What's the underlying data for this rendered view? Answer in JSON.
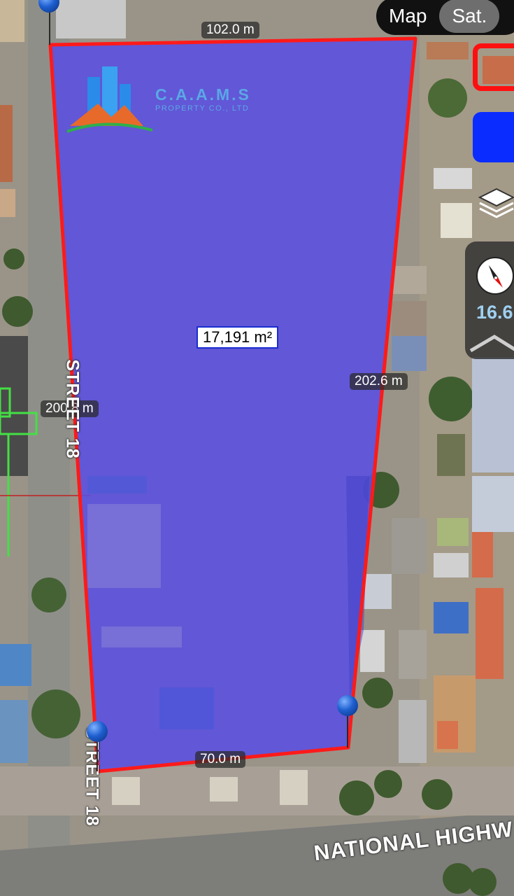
{
  "map": {
    "mode_toggle": {
      "options": [
        "Map",
        "Sat."
      ],
      "selected": "Sat."
    },
    "zoom_level": "16.6",
    "area_label": "17,191 m²",
    "edge_labels": {
      "top": "102.0 m",
      "right": "202.6 m",
      "left": "200.8 m",
      "bottom": "70.0 m"
    },
    "street_labels": {
      "left_upper": "STREET 18",
      "left_lower": "STREET 18",
      "highway": "NATIONAL HIGHW"
    },
    "watermark": {
      "name": "C.A.A.M.S",
      "subtitle": "PROPERTY CO., LTD"
    },
    "icons": [
      "layers-icon",
      "compass-icon",
      "chevron-up-icon",
      "map-pin-icon"
    ],
    "colors": {
      "boundary": "#ff1a1a",
      "fill": "#5a4ee0",
      "accent_blue": "#0a2cff"
    }
  }
}
